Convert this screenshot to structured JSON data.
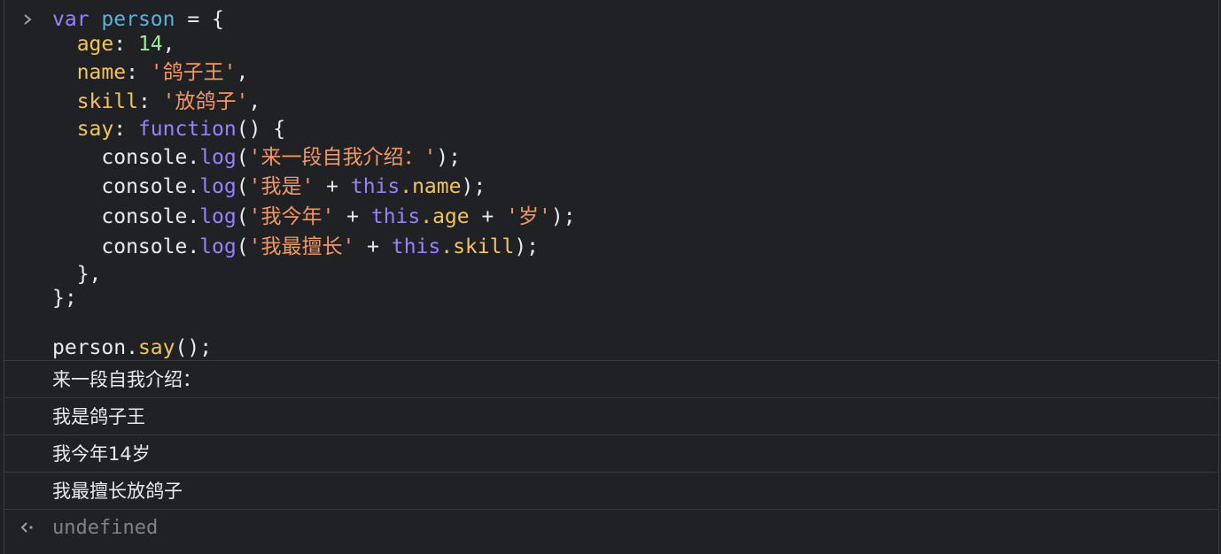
{
  "console": {
    "prompt_icon": "chevron-right-icon",
    "result_icon": "return-arrow-icon",
    "code": {
      "l1": {
        "kw": "var",
        "name": "person",
        "rest": " = {"
      },
      "l2": {
        "prop": "age",
        "sep": ": ",
        "num": "14",
        "end": ","
      },
      "l3": {
        "prop": "name",
        "sep": ": ",
        "str": "'鸽子王'",
        "end": ","
      },
      "l4": {
        "prop": "skill",
        "sep": ": ",
        "str": "'放鸽子'",
        "end": ","
      },
      "l5": {
        "prop": "say",
        "sep": ": ",
        "fn": "function",
        "end": "() {"
      },
      "l6": {
        "obj": "console",
        "dot": ".",
        "meth": "log",
        "open": "(",
        "str": "'来一段自我介绍：'",
        "close": ");"
      },
      "l7": {
        "obj": "console",
        "dot": ".",
        "meth": "log",
        "open": "(",
        "str": "'我是'",
        "plus": " + ",
        "this": "this",
        "prop": ".name",
        "close": ");"
      },
      "l8": {
        "obj": "console",
        "dot": ".",
        "meth": "log",
        "open": "(",
        "str": "'我今年'",
        "plus": " + ",
        "this": "this",
        "prop": ".age",
        "plus2": " + ",
        "str2": "'岁'",
        "close": ");"
      },
      "l9": {
        "obj": "console",
        "dot": ".",
        "meth": "log",
        "open": "(",
        "str": "'我最擅长'",
        "plus": " + ",
        "this": "this",
        "prop": ".skill",
        "close": ");"
      },
      "l10": "},",
      "l11": "};",
      "l12": {
        "obj": "person",
        "dot": ".",
        "meth": "say",
        "end": "();"
      }
    },
    "outputs": [
      "来一段自我介绍：",
      "我是鸽子王",
      "我今年14岁",
      "我最擅长放鸽子"
    ],
    "result": "undefined"
  }
}
